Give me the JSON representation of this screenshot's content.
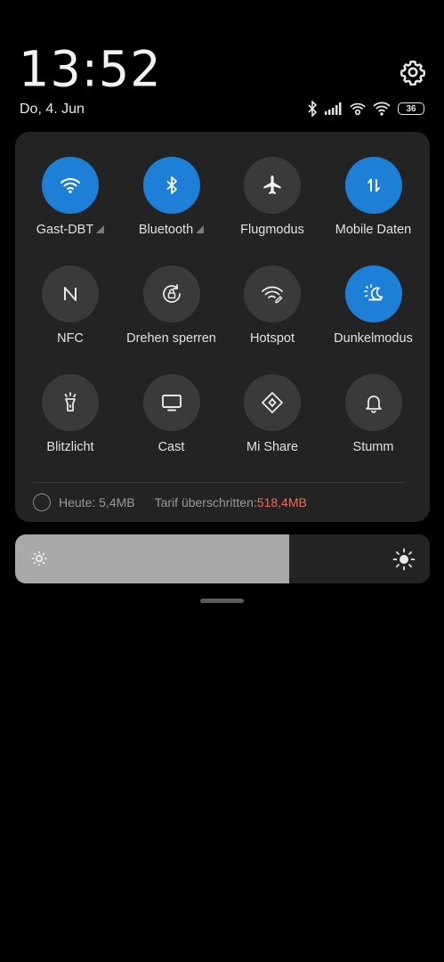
{
  "status": {
    "time": "13:52",
    "date": "Do, 4. Jun",
    "battery": "36"
  },
  "tiles": [
    {
      "label": "Gast-DBT",
      "icon": "wifi-icon",
      "active": true,
      "expand": true
    },
    {
      "label": "Bluetooth",
      "icon": "bluetooth-icon",
      "active": true,
      "expand": true
    },
    {
      "label": "Flugmodus",
      "icon": "airplane-icon",
      "active": false,
      "expand": false
    },
    {
      "label": "Mobile Daten",
      "icon": "mobile-data-icon",
      "active": true,
      "expand": false
    },
    {
      "label": "NFC",
      "icon": "nfc-icon",
      "active": false,
      "expand": false
    },
    {
      "label": "Drehen sperren",
      "icon": "rotation-lock-icon",
      "active": false,
      "expand": false
    },
    {
      "label": "Hotspot",
      "icon": "hotspot-icon",
      "active": false,
      "expand": false
    },
    {
      "label": "Dunkelmodus",
      "icon": "dark-mode-icon",
      "active": true,
      "expand": false
    },
    {
      "label": "Blitzlicht",
      "icon": "flashlight-icon",
      "active": false,
      "expand": false
    },
    {
      "label": "Cast",
      "icon": "cast-icon",
      "active": false,
      "expand": false
    },
    {
      "label": "Mi Share",
      "icon": "mi-share-icon",
      "active": false,
      "expand": false
    },
    {
      "label": "Stumm",
      "icon": "bell-icon",
      "active": false,
      "expand": false
    }
  ],
  "usage": {
    "today": "Heute: 5,4MB",
    "tariff_label": "Tarif überschritten: ",
    "tariff_value": "518,4MB"
  },
  "brightness": {
    "level": 0.66
  },
  "colors": {
    "accent": "#1e7fd6",
    "panel": "#232323",
    "tile_inactive": "#3a3a3a",
    "warning": "#f06a57"
  }
}
